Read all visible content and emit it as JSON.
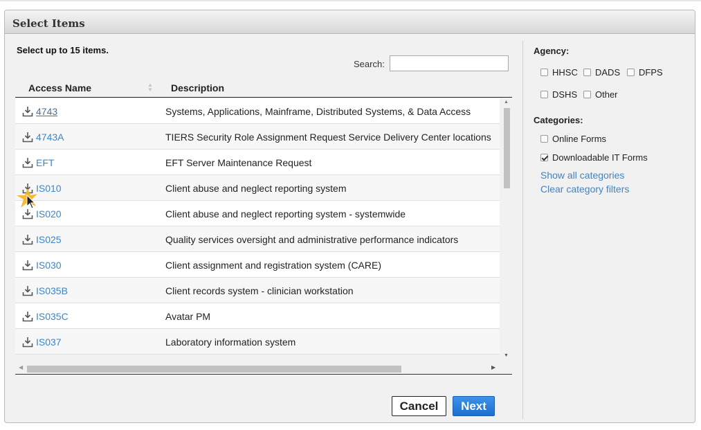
{
  "dialog": {
    "title": "Select Items",
    "instruction": "Select up to 15 items.",
    "search": {
      "label": "Search:",
      "value": "",
      "placeholder": ""
    },
    "table": {
      "columns": [
        "Access Name",
        "Description"
      ],
      "rows": [
        {
          "name": "4743",
          "description": "Systems, Applications, Mainframe, Distributed Systems, & Data Access"
        },
        {
          "name": "4743A",
          "description": "TIERS Security Role Assignment Request Service Delivery Center locations"
        },
        {
          "name": "EFT",
          "description": "EFT Server Maintenance Request"
        },
        {
          "name": "IS010",
          "description": "Client abuse and neglect reporting system"
        },
        {
          "name": "IS020",
          "description": "Client abuse and neglect reporting system - systemwide"
        },
        {
          "name": "IS025",
          "description": "Quality services oversight and administrative performance indicators"
        },
        {
          "name": "IS030",
          "description": "Client assignment and registration system (CARE)"
        },
        {
          "name": "IS035B",
          "description": "Client records system - clinician workstation"
        },
        {
          "name": "IS035C",
          "description": "Avatar PM"
        },
        {
          "name": "IS037",
          "description": "Laboratory information system"
        }
      ]
    },
    "buttons": {
      "cancel": "Cancel",
      "next": "Next"
    }
  },
  "filters": {
    "agency_title": "Agency:",
    "agencies": [
      {
        "label": "HHSC",
        "checked": false
      },
      {
        "label": "DADS",
        "checked": false
      },
      {
        "label": "DFPS",
        "checked": false
      },
      {
        "label": "DSHS",
        "checked": false
      },
      {
        "label": "Other",
        "checked": false
      }
    ],
    "categories_title": "Categories:",
    "categories": [
      {
        "label": "Online Forms",
        "checked": false
      },
      {
        "label": "Downloadable IT Forms",
        "checked": true
      }
    ],
    "show_all": "Show all categories",
    "clear": "Clear category filters"
  },
  "colors": {
    "link": "#3d85c6",
    "next_button": "#2a7de0",
    "header_bg": "#dcdcdc"
  }
}
